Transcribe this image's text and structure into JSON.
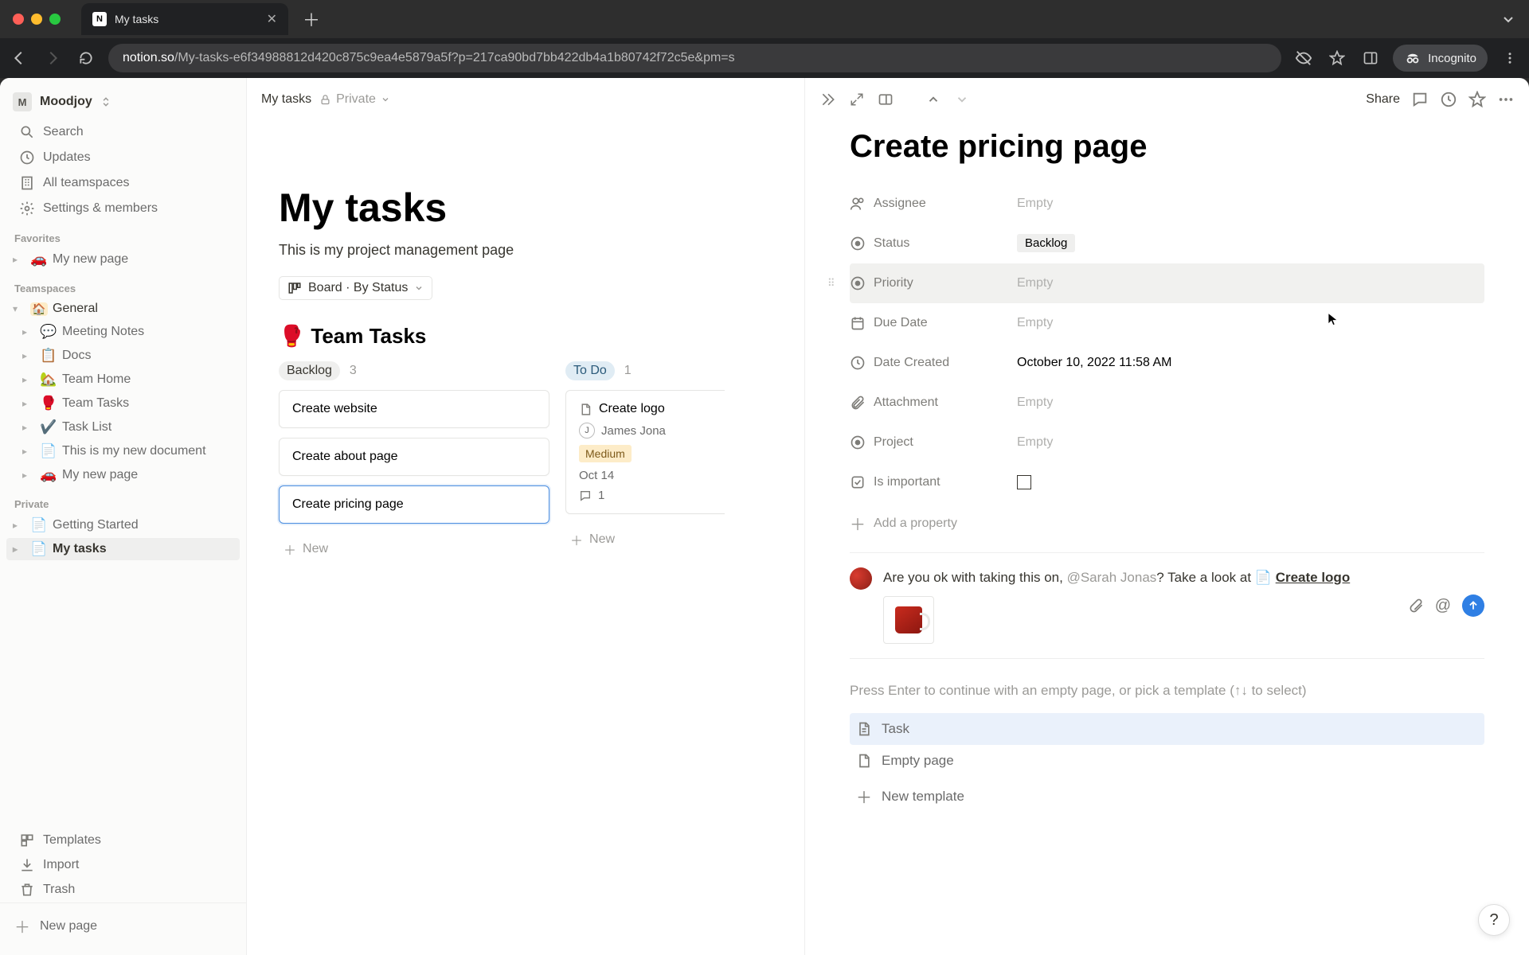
{
  "browser": {
    "tab_title": "My tasks",
    "url_host": "notion.so",
    "url_path": "/My-tasks-e6f34988812d420c875c9ea4e5879a5f?p=217ca90bd7bb422db4a1b80742f72c5e&pm=s",
    "incognito_label": "Incognito"
  },
  "workspace": {
    "name": "Moodjoy",
    "initial": "M"
  },
  "sidebar": {
    "items": [
      {
        "icon": "search",
        "label": "Search"
      },
      {
        "icon": "clock",
        "label": "Updates"
      },
      {
        "icon": "building",
        "label": "All teamspaces"
      },
      {
        "icon": "gear",
        "label": "Settings & members"
      }
    ],
    "sections": {
      "favorites_label": "Favorites",
      "favorites": [
        {
          "emoji": "🚗",
          "label": "My new page"
        }
      ],
      "teamspaces_label": "Teamspaces",
      "teamspaces": [
        {
          "emoji": "🏠",
          "label": "General",
          "top": true
        },
        {
          "emoji": "💬",
          "label": "Meeting Notes"
        },
        {
          "emoji": "📋",
          "label": "Docs"
        },
        {
          "emoji": "🏡",
          "label": "Team Home"
        },
        {
          "emoji": "🥊",
          "label": "Team Tasks"
        },
        {
          "emoji": "✔️",
          "label": "Task List"
        },
        {
          "emoji": "📄",
          "label": "This is my new document"
        },
        {
          "emoji": "🚗",
          "label": "My new page"
        }
      ],
      "private_label": "Private",
      "private": [
        {
          "emoji": "📄",
          "label": "Getting Started"
        },
        {
          "emoji": "📄",
          "label": "My tasks",
          "active": true
        }
      ]
    },
    "footer": {
      "templates": "Templates",
      "import": "Import",
      "trash": "Trash",
      "new_page": "New page"
    }
  },
  "topbar": {
    "breadcrumb": "My tasks",
    "privacy": "Private",
    "share": "Share"
  },
  "page": {
    "title": "My tasks",
    "subtitle": "This is my project management page",
    "view_label": "Board · By Status",
    "section_emoji": "🥊",
    "section_title": "Team Tasks",
    "board": {
      "columns": [
        {
          "status": "Backlog",
          "count": "3",
          "chip_class": "chip-backlog",
          "cards": [
            {
              "title": "Create website"
            },
            {
              "title": "Create about page"
            },
            {
              "title": "Create pricing page",
              "selected": true
            }
          ]
        },
        {
          "status": "To Do",
          "count": "1",
          "chip_class": "chip-todo",
          "cards": [
            {
              "title": "Create logo",
              "icon": true,
              "assignee_initial": "J",
              "assignee": "James Jona",
              "priority": "Medium",
              "date": "Oct 14",
              "comments": "1"
            }
          ]
        }
      ],
      "new_label": "New"
    }
  },
  "peek": {
    "title": "Create pricing page",
    "props": [
      {
        "icon": "person",
        "label": "Assignee",
        "value": "Empty",
        "empty": true
      },
      {
        "icon": "status",
        "label": "Status",
        "value": "Backlog",
        "pill": true
      },
      {
        "icon": "status",
        "label": "Priority",
        "value": "Empty",
        "empty": true,
        "hover": true
      },
      {
        "icon": "calendar",
        "label": "Due Date",
        "value": "Empty",
        "empty": true
      },
      {
        "icon": "clock",
        "label": "Date Created",
        "value": "October 10, 2022 11:58 AM"
      },
      {
        "icon": "attach",
        "label": "Attachment",
        "value": "Empty",
        "empty": true
      },
      {
        "icon": "status",
        "label": "Project",
        "value": "Empty",
        "empty": true
      },
      {
        "icon": "check",
        "label": "Is important",
        "checkbox": true
      }
    ],
    "add_property": "Add a property",
    "comment": {
      "text_prefix": "Are you ok with taking this on, ",
      "mention": "@Sarah Jonas",
      "text_mid": "? Take a look at ",
      "link_icon": "📄",
      "link_text": "Create logo"
    },
    "template_hint": "Press Enter to continue with an empty page, or pick a template (↑↓ to select)",
    "templates": [
      {
        "icon": "📄",
        "label": "Task",
        "selected": true
      },
      {
        "icon": "📄",
        "label": "Empty page"
      },
      {
        "icon": "＋",
        "label": "New template"
      }
    ]
  }
}
